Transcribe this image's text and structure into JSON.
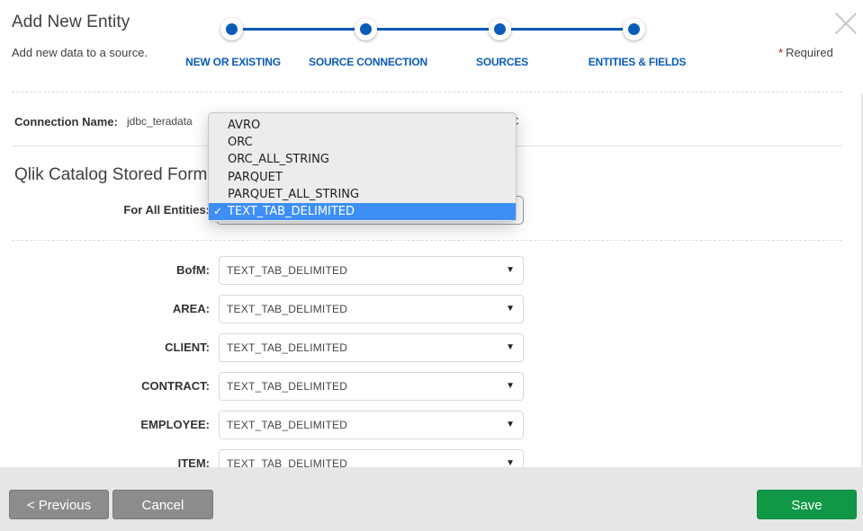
{
  "header": {
    "title": "Add New Entity",
    "subtitle": "Add new data to a source.",
    "required_marker": "*",
    "required_label": "Required"
  },
  "stepper": {
    "accent": "#0b5bb9",
    "steps": [
      {
        "label": "NEW OR EXISTING"
      },
      {
        "label": "SOURCE CONNECTION"
      },
      {
        "label": "SOURCES"
      },
      {
        "label": "ENTITIES & FIELDS"
      }
    ]
  },
  "connection": {
    "label": "Connection Name:",
    "value": "jdbc_teradata",
    "type_partial": "BC"
  },
  "stored_format": {
    "title": "Qlik Catalog Stored Form",
    "for_all_label": "For All Entities:",
    "for_all_value": "TEXT_TAB_DELIMITED",
    "dropdown_open": true,
    "options": [
      {
        "label": "AVRO",
        "selected": false
      },
      {
        "label": "ORC",
        "selected": false
      },
      {
        "label": "ORC_ALL_STRING",
        "selected": false
      },
      {
        "label": "PARQUET",
        "selected": false
      },
      {
        "label": "PARQUET_ALL_STRING",
        "selected": false
      },
      {
        "label": "TEXT_TAB_DELIMITED",
        "selected": true
      }
    ],
    "check_glyph": "✓",
    "selected_color": "#3d8ff5"
  },
  "entities": [
    {
      "label": "BofM:",
      "value": "TEXT_TAB_DELIMITED"
    },
    {
      "label": "AREA:",
      "value": "TEXT_TAB_DELIMITED"
    },
    {
      "label": "CLIENT:",
      "value": "TEXT_TAB_DELIMITED"
    },
    {
      "label": "CONTRACT:",
      "value": "TEXT_TAB_DELIMITED"
    },
    {
      "label": "EMPLOYEE:",
      "value": "TEXT_TAB_DELIMITED"
    },
    {
      "label": "ITEM:",
      "value": "TEXT_TAB_DELIMITED"
    }
  ],
  "caret_glyph": "▼",
  "footer": {
    "previous_label": "< Previous",
    "cancel_label": "Cancel",
    "save_label": "Save",
    "save_color": "#109846"
  }
}
